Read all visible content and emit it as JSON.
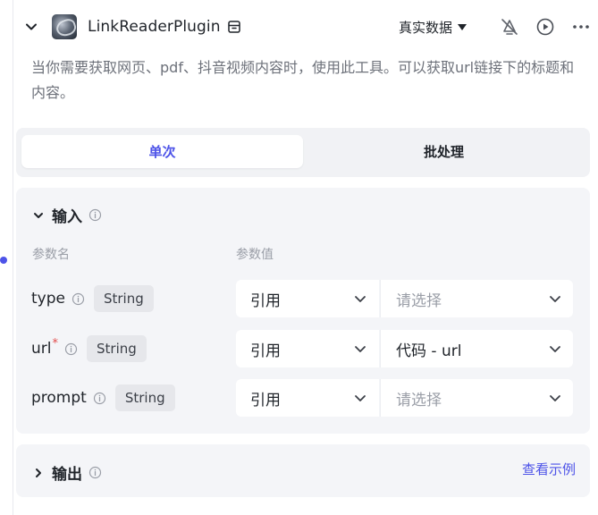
{
  "header": {
    "plugin_name": "LinkReaderPlugin",
    "mode_label": "真实数据"
  },
  "description": "当你需要获取网页、pdf、抖音视频内容时，使用此工具。可以获取url链接下的标题和内容。",
  "tabs": [
    {
      "label": "单次",
      "active": true
    },
    {
      "label": "批处理",
      "active": false
    }
  ],
  "input": {
    "title": "输入",
    "columns": {
      "name": "参数名",
      "value": "参数值"
    },
    "params": [
      {
        "name": "type",
        "required": false,
        "type": "String",
        "source": "引用",
        "value": "请选择",
        "placeholder": true
      },
      {
        "name": "url",
        "required": true,
        "type": "String",
        "source": "引用",
        "value": "代码 - url",
        "placeholder": false
      },
      {
        "name": "prompt",
        "required": false,
        "type": "String",
        "source": "引用",
        "value": "请选择",
        "placeholder": true
      }
    ]
  },
  "output": {
    "title": "输出",
    "view_example": "查看示例"
  },
  "colors": {
    "accent": "#4d53e8",
    "required": "#e24c4c",
    "panel_bg": "#f4f5f8"
  }
}
